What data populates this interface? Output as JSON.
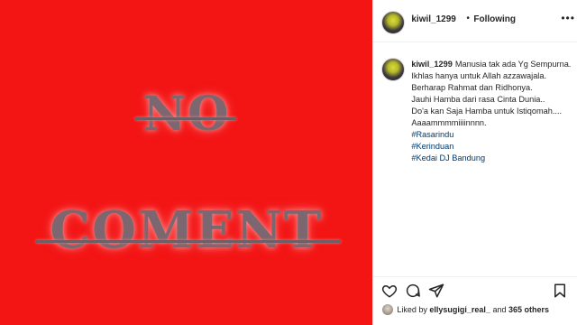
{
  "image": {
    "text_line1": "NO",
    "text_line2": "COMENT",
    "background_color": "#f31414"
  },
  "header": {
    "username": "kiwil_1299",
    "separator": "•",
    "follow_label": "Following",
    "more_label": "•••"
  },
  "caption": {
    "username": "kiwil_1299",
    "lines": [
      "Manusia tak ada Yg Sempurna.",
      "Ikhlas hanya untuk Allah azzawajala.",
      "Berharap Rahmat dan Ridhonya.",
      "Jauhi Hamba dari rasa Cinta Dunia..",
      "Do'a kan Saja Hamba untuk Istiqomah....",
      "Aaaammmmiiiinnnn."
    ],
    "hashtags": [
      "#Rasarindu",
      "#Kerinduan",
      "#Kedai DJ Bandung"
    ]
  },
  "actions": {
    "like_icon": "heart-icon",
    "comment_icon": "comment-icon",
    "share_icon": "share-icon",
    "save_icon": "bookmark-icon"
  },
  "likes": {
    "prefix": "Liked by",
    "user": "ellysugigi_real_",
    "middle": "and",
    "others": "365 others"
  }
}
